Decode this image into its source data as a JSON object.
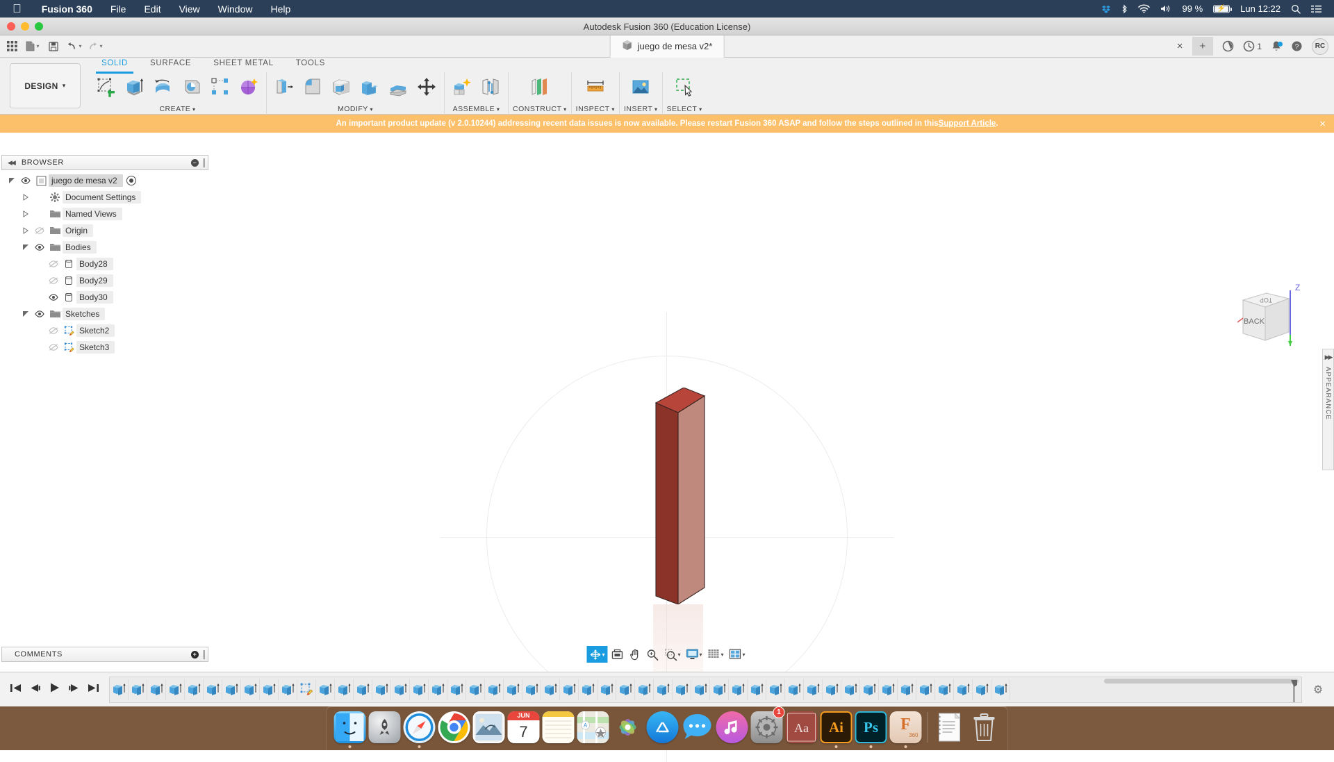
{
  "macos": {
    "apple_menu": "apple-logo",
    "menus": [
      "Fusion 360",
      "File",
      "Edit",
      "View",
      "Window",
      "Help"
    ],
    "status": {
      "battery_percent": "99 %",
      "clock": "Lun 12:22",
      "icons": [
        "dropbox-icon",
        "bluetooth-icon",
        "wifi-icon",
        "volume-icon",
        "battery-charging-icon",
        "spotlight-search-icon",
        "control-center-icon"
      ]
    }
  },
  "window": {
    "title": "Autodesk Fusion 360 (Education License)",
    "traffic_lights": [
      "close",
      "minimize",
      "zoom"
    ]
  },
  "qat": {
    "items": [
      "grid-menu-icon",
      "new-file-icon",
      "save-icon",
      "undo-icon",
      "redo-icon"
    ]
  },
  "document_tab": {
    "name": "juego de mesa v2*",
    "icon": "cube-icon",
    "close_label": "×",
    "new_tab_label": "+"
  },
  "tab_actions": {
    "jobs_icon": "jobs-status-icon",
    "history_icon": "recent-icon",
    "history_count": "1",
    "notifications_icon": "bell-icon",
    "help_icon": "help-icon",
    "avatar_initials": "RC"
  },
  "ribbon": {
    "workspace_button": "DESIGN",
    "tabs": [
      {
        "label": "SOLID",
        "active": true
      },
      {
        "label": "SURFACE",
        "active": false
      },
      {
        "label": "SHEET METAL",
        "active": false
      },
      {
        "label": "TOOLS",
        "active": false
      }
    ],
    "panels": [
      {
        "label": "CREATE",
        "dropdown": true,
        "commands": [
          "create-sketch-icon",
          "extrude-icon",
          "revolve-icon",
          "sweep-icon",
          "pattern-icon",
          "create-form-icon"
        ]
      },
      {
        "label": "MODIFY",
        "dropdown": true,
        "commands": [
          "press-pull-icon",
          "fillet-icon",
          "shell-icon",
          "combine-icon",
          "offset-face-icon",
          "move-copy-icon"
        ]
      },
      {
        "label": "ASSEMBLE",
        "dropdown": true,
        "commands": [
          "new-component-icon",
          "joint-icon"
        ]
      },
      {
        "label": "CONSTRUCT",
        "dropdown": true,
        "commands": [
          "offset-plane-icon"
        ]
      },
      {
        "label": "INSPECT",
        "dropdown": true,
        "commands": [
          "measure-icon"
        ]
      },
      {
        "label": "INSERT",
        "dropdown": true,
        "commands": [
          "insert-canvas-icon"
        ]
      },
      {
        "label": "SELECT",
        "dropdown": true,
        "commands": [
          "window-selection-icon"
        ]
      }
    ]
  },
  "banner": {
    "text_before": "An important product update (v 2.0.10244) addressing recent data issues is now available. Please restart Fusion 360 ASAP and follow the steps outlined in this ",
    "link_text": "Support Article",
    "text_after": ".",
    "close_label": "×",
    "background": "#fcc06a"
  },
  "browser": {
    "title": "BROWSER",
    "collapse_icon": "collapse-left-icon",
    "tree": [
      {
        "label": "juego de mesa v2",
        "indent": 0,
        "twisty": "open",
        "eye": "visible",
        "icon": "component-icon",
        "root": true,
        "activate": true
      },
      {
        "label": "Document Settings",
        "indent": 1,
        "twisty": "closed",
        "eye": "none",
        "icon": "gear-icon"
      },
      {
        "label": "Named Views",
        "indent": 1,
        "twisty": "closed",
        "eye": "none",
        "icon": "folder-icon"
      },
      {
        "label": "Origin",
        "indent": 1,
        "twisty": "closed",
        "eye": "hidden",
        "icon": "folder-icon"
      },
      {
        "label": "Bodies",
        "indent": 1,
        "twisty": "open",
        "eye": "visible",
        "icon": "folder-icon"
      },
      {
        "label": "Body28",
        "indent": 2,
        "twisty": "none",
        "eye": "hidden",
        "icon": "body-icon"
      },
      {
        "label": "Body29",
        "indent": 2,
        "twisty": "none",
        "eye": "hidden",
        "icon": "body-icon"
      },
      {
        "label": "Body30",
        "indent": 2,
        "twisty": "none",
        "eye": "visible",
        "icon": "body-icon"
      },
      {
        "label": "Sketches",
        "indent": 1,
        "twisty": "open",
        "eye": "visible",
        "icon": "folder-icon"
      },
      {
        "label": "Sketch2",
        "indent": 2,
        "twisty": "none",
        "eye": "hidden",
        "icon": "sketch-icon"
      },
      {
        "label": "Sketch3",
        "indent": 2,
        "twisty": "none",
        "eye": "hidden",
        "icon": "sketch-icon"
      }
    ]
  },
  "comments": {
    "title": "COMMENTS",
    "add_icon": "add-comment-icon"
  },
  "appearance_rail": {
    "label": "APPEARANCE",
    "expand_icon": "expand-left-icon"
  },
  "canvas": {
    "body_color_front": "#8b3328",
    "body_color_side": "#c0897e",
    "body_color_top": "#b8453a",
    "grid_color": "#ececec",
    "viewcube": {
      "front_face": "BACK",
      "top_face": "TOP",
      "axis_label": "Z"
    }
  },
  "navbar": {
    "buttons": [
      {
        "name": "orbit-icon",
        "active": true,
        "dropdown": true
      },
      {
        "name": "look-at-icon",
        "active": false,
        "dropdown": false
      },
      {
        "name": "pan-icon",
        "active": false,
        "dropdown": false
      },
      {
        "name": "zoom-icon",
        "active": false,
        "dropdown": false
      },
      {
        "name": "fit-icon",
        "active": false,
        "dropdown": true
      },
      {
        "name": "display-settings-icon",
        "active": false,
        "dropdown": true
      },
      {
        "name": "grid-snap-icon",
        "active": false,
        "dropdown": true
      },
      {
        "name": "viewports-icon",
        "active": false,
        "dropdown": true
      }
    ]
  },
  "timeline": {
    "controls": [
      "skip-to-start-icon",
      "step-back-icon",
      "play-icon",
      "step-forward-icon",
      "skip-to-end-icon"
    ],
    "settings_icon": "gear-icon",
    "features": [
      "extrude-icon",
      "extrude-icon",
      "extrude-icon",
      "extrude-icon",
      "extrude-icon",
      "extrude-icon",
      "extrude-icon",
      "extrude-icon",
      "extrude-icon",
      "extrude-icon",
      "sketch-icon",
      "extrude-icon",
      "extrude-icon",
      "extrude-icon",
      "extrude-icon",
      "extrude-icon",
      "extrude-icon",
      "extrude-icon",
      "extrude-icon",
      "extrude-icon",
      "extrude-icon",
      "extrude-icon",
      "extrude-icon",
      "extrude-icon",
      "extrude-icon",
      "extrude-icon",
      "extrude-icon",
      "extrude-icon",
      "extrude-icon",
      "extrude-icon",
      "extrude-icon",
      "extrude-icon",
      "extrude-icon",
      "extrude-icon",
      "extrude-icon",
      "extrude-icon",
      "extrude-icon",
      "extrude-icon",
      "extrude-icon",
      "extrude-icon",
      "extrude-icon",
      "extrude-icon",
      "extrude-icon",
      "extrude-icon",
      "extrude-icon",
      "extrude-icon",
      "extrude-icon",
      "extrude-icon"
    ]
  },
  "dock": {
    "apps": [
      {
        "name": "finder",
        "label": "Finder",
        "running": true
      },
      {
        "name": "launchpad",
        "label": "Launchpad",
        "running": false
      },
      {
        "name": "safari",
        "label": "Safari",
        "running": true
      },
      {
        "name": "chrome",
        "label": "Google Chrome",
        "running": false
      },
      {
        "name": "mail",
        "label": "Mail",
        "running": false
      },
      {
        "name": "calendar",
        "label": "Calendar",
        "running": false,
        "month": "JUN",
        "day": "7"
      },
      {
        "name": "notes",
        "label": "Notes",
        "running": false
      },
      {
        "name": "maps",
        "label": "Maps",
        "running": false
      },
      {
        "name": "photos",
        "label": "Photos",
        "running": false
      },
      {
        "name": "appstore",
        "label": "App Store",
        "running": false
      },
      {
        "name": "messages",
        "label": "Messages",
        "running": false
      },
      {
        "name": "itunes",
        "label": "iTunes",
        "running": false
      },
      {
        "name": "system-preferences",
        "label": "System Preferences",
        "running": false,
        "badge": "1"
      },
      {
        "name": "dictionary",
        "label": "Dictionary",
        "running": false
      },
      {
        "name": "illustrator",
        "label": "Adobe Illustrator",
        "running": true,
        "short": "Ai"
      },
      {
        "name": "photoshop",
        "label": "Adobe Photoshop",
        "running": true,
        "short": "Ps"
      },
      {
        "name": "fusion360",
        "label": "Fusion 360",
        "running": true,
        "short": "F",
        "sub": "360"
      },
      {
        "name": "documents-stack",
        "label": "Documents",
        "running": false
      },
      {
        "name": "trash",
        "label": "Trash",
        "running": false
      }
    ]
  }
}
